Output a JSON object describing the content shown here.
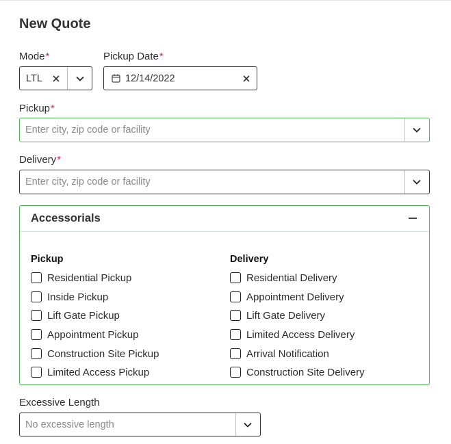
{
  "page_title": "New Quote",
  "required_mark": "*",
  "mode": {
    "label": "Mode",
    "value": "LTL"
  },
  "pickup_date": {
    "label": "Pickup Date",
    "value": "12/14/2022"
  },
  "pickup": {
    "label": "Pickup",
    "placeholder": "Enter city, zip code or facility"
  },
  "delivery": {
    "label": "Delivery",
    "placeholder": "Enter city, zip code or facility"
  },
  "accessorials": {
    "title": "Accessorials",
    "pickup_heading": "Pickup",
    "delivery_heading": "Delivery",
    "pickup_items": [
      "Residential Pickup",
      "Inside Pickup",
      "Lift Gate Pickup",
      "Appointment Pickup",
      "Construction Site Pickup",
      "Limited Access Pickup"
    ],
    "delivery_items": [
      "Residential Delivery",
      "Appointment Delivery",
      "Lift Gate Delivery",
      "Limited Access Delivery",
      "Arrival Notification",
      "Construction Site Delivery"
    ]
  },
  "excessive_length": {
    "label": "Excessive Length",
    "placeholder": "No excessive length"
  },
  "colors": {
    "accent_green": "#4caf50",
    "required_red": "#e0245e",
    "border": "#333333"
  }
}
